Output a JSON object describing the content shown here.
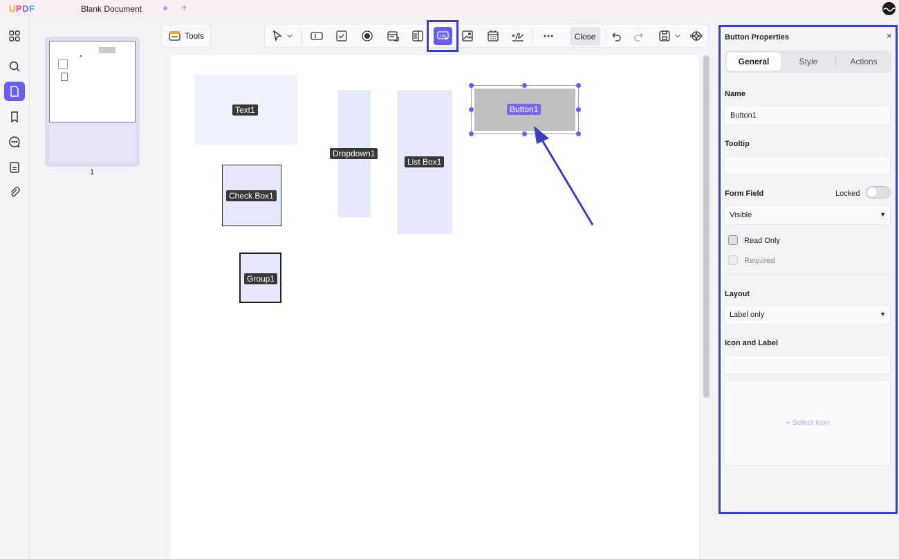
{
  "app": {
    "logo_letters": [
      "U",
      "P",
      "D",
      "F"
    ],
    "document_tab": "Blank Document",
    "new_tab_symbol": "+"
  },
  "thumbnails": {
    "page_number": "1"
  },
  "tools_button": {
    "label": "Tools",
    "icon": "toolbox-icon"
  },
  "toolbar": {
    "icons": [
      "select-cursor-icon",
      "chevron-down-icon",
      "text-field-icon",
      "checkbox-icon",
      "radio-button-icon",
      "combo-box-icon",
      "list-box-icon",
      "button-field-icon",
      "image-field-icon",
      "date-field-icon",
      "signature-icon",
      "more-icon",
      "undo-icon",
      "redo-icon",
      "save-icon",
      "ai-assistant-icon"
    ],
    "close_label": "Close",
    "active_tool": "button-field-icon"
  },
  "canvas": {
    "fields": [
      {
        "name": "text",
        "label": "Text1"
      },
      {
        "name": "dropdown",
        "label": "Dropdown1"
      },
      {
        "name": "listbox",
        "label": "List Box1"
      },
      {
        "name": "button",
        "label": "Button1"
      },
      {
        "name": "checkbox",
        "label": "Check Box1"
      },
      {
        "name": "group",
        "label": "Group1"
      }
    ]
  },
  "properties": {
    "title": "Button Properties",
    "close_symbol": "×",
    "tabs": [
      "General",
      "Style",
      "Actions"
    ],
    "active_tab": "General",
    "name_label": "Name",
    "name_value": "Button1",
    "tooltip_label": "Tooltip",
    "tooltip_value": "",
    "form_field_label": "Form Field",
    "locked_label": "Locked",
    "locked": false,
    "visibility": "Visible",
    "read_only_label": "Read Only",
    "required_label": "Required",
    "layout_label": "Layout",
    "layout_value": "Label only",
    "icon_label_label": "Icon and Label",
    "icon_label_value": "",
    "select_icon": "+ Select Icon"
  },
  "colors": {
    "accent": "#6b5cf0",
    "highlight_border": "#3d3cc4",
    "field_fill": "#e6e9fb",
    "button_fill": "#bfbfbf"
  }
}
